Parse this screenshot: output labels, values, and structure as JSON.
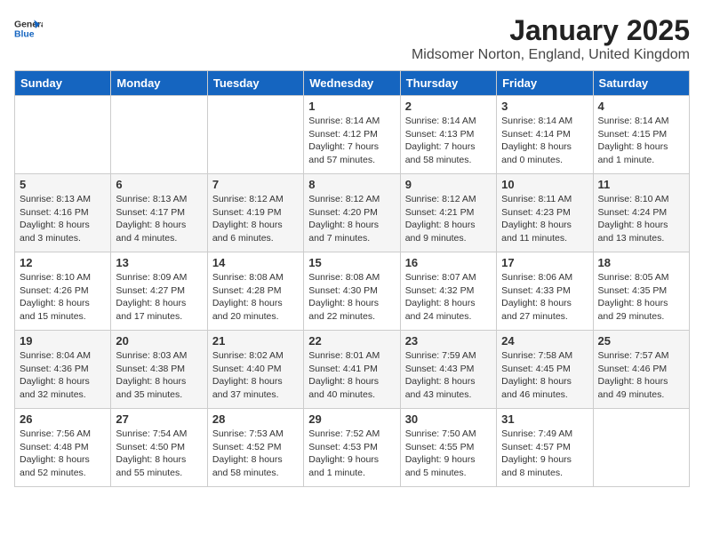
{
  "header": {
    "logo_line1": "General",
    "logo_line2": "Blue",
    "month": "January 2025",
    "location": "Midsomer Norton, England, United Kingdom"
  },
  "days_of_week": [
    "Sunday",
    "Monday",
    "Tuesday",
    "Wednesday",
    "Thursday",
    "Friday",
    "Saturday"
  ],
  "weeks": [
    [
      {
        "day": "",
        "info": ""
      },
      {
        "day": "",
        "info": ""
      },
      {
        "day": "",
        "info": ""
      },
      {
        "day": "1",
        "info": "Sunrise: 8:14 AM\nSunset: 4:12 PM\nDaylight: 7 hours and 57 minutes."
      },
      {
        "day": "2",
        "info": "Sunrise: 8:14 AM\nSunset: 4:13 PM\nDaylight: 7 hours and 58 minutes."
      },
      {
        "day": "3",
        "info": "Sunrise: 8:14 AM\nSunset: 4:14 PM\nDaylight: 8 hours and 0 minutes."
      },
      {
        "day": "4",
        "info": "Sunrise: 8:14 AM\nSunset: 4:15 PM\nDaylight: 8 hours and 1 minute."
      }
    ],
    [
      {
        "day": "5",
        "info": "Sunrise: 8:13 AM\nSunset: 4:16 PM\nDaylight: 8 hours and 3 minutes."
      },
      {
        "day": "6",
        "info": "Sunrise: 8:13 AM\nSunset: 4:17 PM\nDaylight: 8 hours and 4 minutes."
      },
      {
        "day": "7",
        "info": "Sunrise: 8:12 AM\nSunset: 4:19 PM\nDaylight: 8 hours and 6 minutes."
      },
      {
        "day": "8",
        "info": "Sunrise: 8:12 AM\nSunset: 4:20 PM\nDaylight: 8 hours and 7 minutes."
      },
      {
        "day": "9",
        "info": "Sunrise: 8:12 AM\nSunset: 4:21 PM\nDaylight: 8 hours and 9 minutes."
      },
      {
        "day": "10",
        "info": "Sunrise: 8:11 AM\nSunset: 4:23 PM\nDaylight: 8 hours and 11 minutes."
      },
      {
        "day": "11",
        "info": "Sunrise: 8:10 AM\nSunset: 4:24 PM\nDaylight: 8 hours and 13 minutes."
      }
    ],
    [
      {
        "day": "12",
        "info": "Sunrise: 8:10 AM\nSunset: 4:26 PM\nDaylight: 8 hours and 15 minutes."
      },
      {
        "day": "13",
        "info": "Sunrise: 8:09 AM\nSunset: 4:27 PM\nDaylight: 8 hours and 17 minutes."
      },
      {
        "day": "14",
        "info": "Sunrise: 8:08 AM\nSunset: 4:28 PM\nDaylight: 8 hours and 20 minutes."
      },
      {
        "day": "15",
        "info": "Sunrise: 8:08 AM\nSunset: 4:30 PM\nDaylight: 8 hours and 22 minutes."
      },
      {
        "day": "16",
        "info": "Sunrise: 8:07 AM\nSunset: 4:32 PM\nDaylight: 8 hours and 24 minutes."
      },
      {
        "day": "17",
        "info": "Sunrise: 8:06 AM\nSunset: 4:33 PM\nDaylight: 8 hours and 27 minutes."
      },
      {
        "day": "18",
        "info": "Sunrise: 8:05 AM\nSunset: 4:35 PM\nDaylight: 8 hours and 29 minutes."
      }
    ],
    [
      {
        "day": "19",
        "info": "Sunrise: 8:04 AM\nSunset: 4:36 PM\nDaylight: 8 hours and 32 minutes."
      },
      {
        "day": "20",
        "info": "Sunrise: 8:03 AM\nSunset: 4:38 PM\nDaylight: 8 hours and 35 minutes."
      },
      {
        "day": "21",
        "info": "Sunrise: 8:02 AM\nSunset: 4:40 PM\nDaylight: 8 hours and 37 minutes."
      },
      {
        "day": "22",
        "info": "Sunrise: 8:01 AM\nSunset: 4:41 PM\nDaylight: 8 hours and 40 minutes."
      },
      {
        "day": "23",
        "info": "Sunrise: 7:59 AM\nSunset: 4:43 PM\nDaylight: 8 hours and 43 minutes."
      },
      {
        "day": "24",
        "info": "Sunrise: 7:58 AM\nSunset: 4:45 PM\nDaylight: 8 hours and 46 minutes."
      },
      {
        "day": "25",
        "info": "Sunrise: 7:57 AM\nSunset: 4:46 PM\nDaylight: 8 hours and 49 minutes."
      }
    ],
    [
      {
        "day": "26",
        "info": "Sunrise: 7:56 AM\nSunset: 4:48 PM\nDaylight: 8 hours and 52 minutes."
      },
      {
        "day": "27",
        "info": "Sunrise: 7:54 AM\nSunset: 4:50 PM\nDaylight: 8 hours and 55 minutes."
      },
      {
        "day": "28",
        "info": "Sunrise: 7:53 AM\nSunset: 4:52 PM\nDaylight: 8 hours and 58 minutes."
      },
      {
        "day": "29",
        "info": "Sunrise: 7:52 AM\nSunset: 4:53 PM\nDaylight: 9 hours and 1 minute."
      },
      {
        "day": "30",
        "info": "Sunrise: 7:50 AM\nSunset: 4:55 PM\nDaylight: 9 hours and 5 minutes."
      },
      {
        "day": "31",
        "info": "Sunrise: 7:49 AM\nSunset: 4:57 PM\nDaylight: 9 hours and 8 minutes."
      },
      {
        "day": "",
        "info": ""
      }
    ]
  ]
}
